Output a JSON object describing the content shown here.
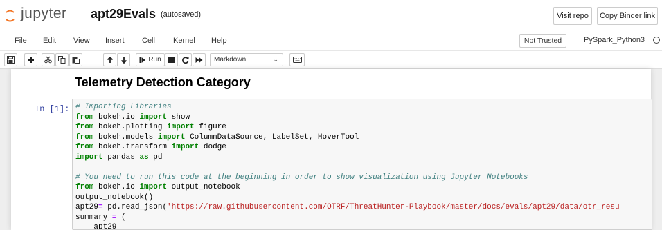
{
  "header": {
    "brand": "jupyter",
    "notebook_name": "apt29Evals",
    "save_status": "(autosaved)",
    "visit_repo": "Visit repo",
    "copy_binder": "Copy Binder link"
  },
  "menu": {
    "items": [
      "File",
      "Edit",
      "View",
      "Insert",
      "Cell",
      "Kernel",
      "Help"
    ],
    "trust_status": "Not Trusted",
    "kernel_name": "PySpark_Python3"
  },
  "toolbar": {
    "run_label": "Run",
    "cell_type": "Markdown"
  },
  "notebook": {
    "heading": "Telemetry Detection Category",
    "prompt": "In [1]:",
    "code": {
      "c1": "# Importing Libraries",
      "l2": [
        "from",
        "bokeh.io",
        "import",
        "show"
      ],
      "l3": [
        "from",
        "bokeh.plotting",
        "import",
        "figure"
      ],
      "l4": [
        "from",
        "bokeh.models",
        "import",
        "ColumnDataSource, LabelSet, HoverTool"
      ],
      "l5": [
        "from",
        "bokeh.transform",
        "import",
        "dodge"
      ],
      "l6": [
        "import",
        "pandas",
        "as",
        "pd"
      ],
      "c8": "# You need to run this code at the beginning in order to show visualization using Jupyter Notebooks",
      "l9": [
        "from",
        "bokeh.io",
        "import",
        "output_notebook"
      ],
      "l10": "output_notebook()",
      "l11_a": "apt29",
      "l11_eq": "=",
      "l11_b": " pd.read_json(",
      "l11_s": "'https://raw.githubusercontent.com/OTRF/ThreatHunter-Playbook/master/docs/evals/apt29/data/otr_resu",
      "l12_a": "summary ",
      "l12_eq": "=",
      "l12_b": " (",
      "l13": "    apt29"
    }
  }
}
